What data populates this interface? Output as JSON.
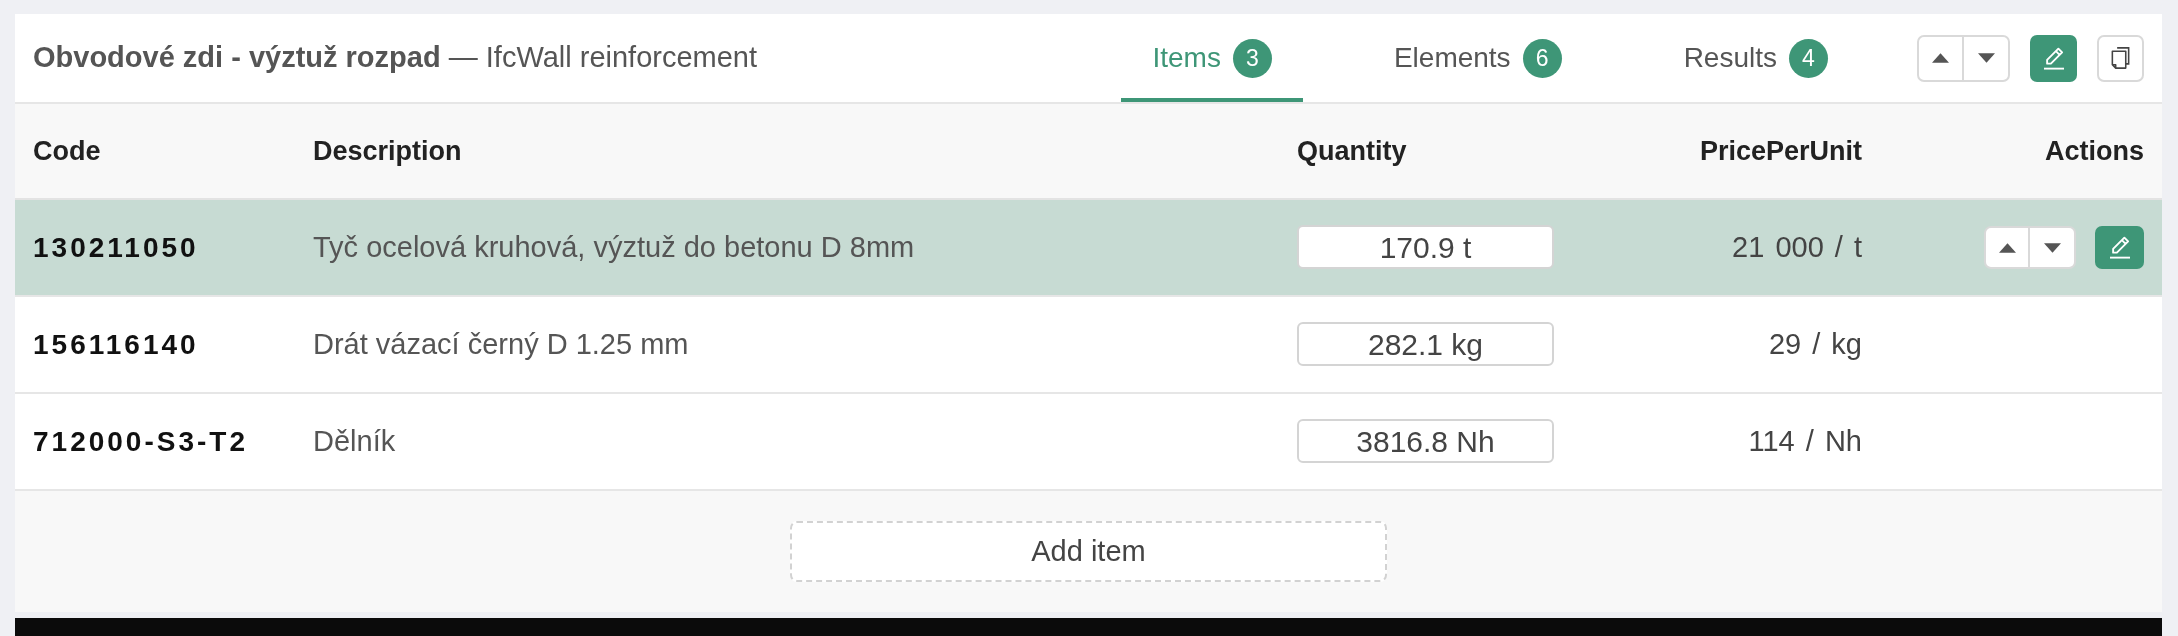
{
  "panel": {
    "title": "**Obvodové zdi - výztuž rozpad** — IfcWall reinforcement"
  },
  "tabs": [
    {
      "label": "Items",
      "count": "3",
      "selected": true
    },
    {
      "label": "Elements",
      "count": "6",
      "selected": false
    },
    {
      "label": "Results",
      "count": "4",
      "selected": false
    }
  ],
  "table": {
    "columns": [
      "Code",
      "Description",
      "Quantity",
      "PricePerUnit",
      "Actions"
    ],
    "rows": [
      {
        "code": "130211050",
        "description": "Tyč ocelová kruhová, výztuž do betonu D 8mm",
        "quantity": "170.9 t",
        "price": "21 000 / t",
        "selected": true
      },
      {
        "code": "156116140",
        "description": "Drát vázací černý D 1.25 mm",
        "quantity": "282.1 kg",
        "price": "29 / kg",
        "selected": false
      },
      {
        "code": "712000-S3-T2",
        "description": "Dělník",
        "quantity": "3816.8 Nh",
        "price": "114 / Nh",
        "selected": false
      }
    ]
  },
  "footer": {
    "add_button": "Add item"
  }
}
